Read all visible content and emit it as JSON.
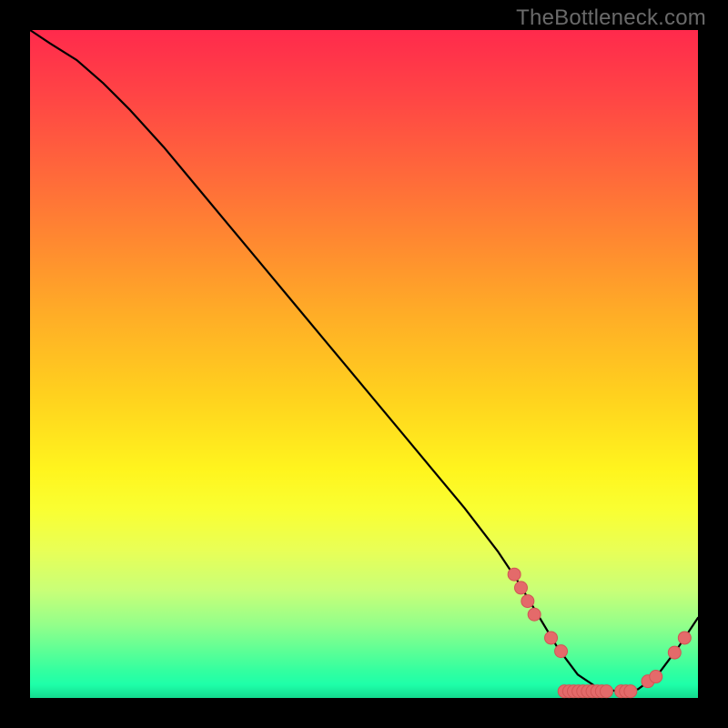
{
  "branding": "TheBottleneck.com",
  "chart_data": {
    "type": "line",
    "title": "",
    "xlabel": "",
    "ylabel": "",
    "xlim": [
      0,
      100
    ],
    "ylim": [
      0,
      100
    ],
    "grid": false,
    "legend": false,
    "series": [
      {
        "name": "curve",
        "color": "#000000",
        "x": [
          0,
          3,
          7,
          11,
          15,
          20,
          25,
          30,
          35,
          40,
          45,
          50,
          55,
          60,
          65,
          70,
          73,
          76,
          79,
          82,
          85,
          88,
          91,
          94,
          97,
          100
        ],
        "y": [
          100,
          98,
          95.5,
          92,
          88,
          82.5,
          76.5,
          70.5,
          64.5,
          58.5,
          52.5,
          46.5,
          40.5,
          34.5,
          28.5,
          22,
          17.5,
          12.5,
          7.5,
          3.5,
          1.5,
          1,
          1.3,
          3.5,
          7.5,
          12
        ]
      }
    ],
    "markers": [
      {
        "x": 72.5,
        "y": 18.5
      },
      {
        "x": 73.5,
        "y": 16.5
      },
      {
        "x": 74.5,
        "y": 14.5
      },
      {
        "x": 75.5,
        "y": 12.5
      },
      {
        "x": 78.0,
        "y": 9.0
      },
      {
        "x": 79.5,
        "y": 7.0
      },
      {
        "x": 80.0,
        "y": 1.0
      },
      {
        "x": 80.7,
        "y": 1.0
      },
      {
        "x": 81.4,
        "y": 1.0
      },
      {
        "x": 82.1,
        "y": 1.0
      },
      {
        "x": 82.8,
        "y": 1.0
      },
      {
        "x": 83.5,
        "y": 1.0
      },
      {
        "x": 84.2,
        "y": 1.0
      },
      {
        "x": 84.9,
        "y": 1.0
      },
      {
        "x": 85.6,
        "y": 1.0
      },
      {
        "x": 86.3,
        "y": 1.0
      },
      {
        "x": 88.5,
        "y": 1.0
      },
      {
        "x": 89.2,
        "y": 1.0
      },
      {
        "x": 89.9,
        "y": 1.0
      },
      {
        "x": 92.5,
        "y": 2.5
      },
      {
        "x": 93.7,
        "y": 3.2
      },
      {
        "x": 96.5,
        "y": 6.8
      },
      {
        "x": 98.0,
        "y": 9.0
      }
    ],
    "marker_style": {
      "fill": "#e46a6a",
      "stroke": "#d15555",
      "radius_px": 7
    }
  }
}
